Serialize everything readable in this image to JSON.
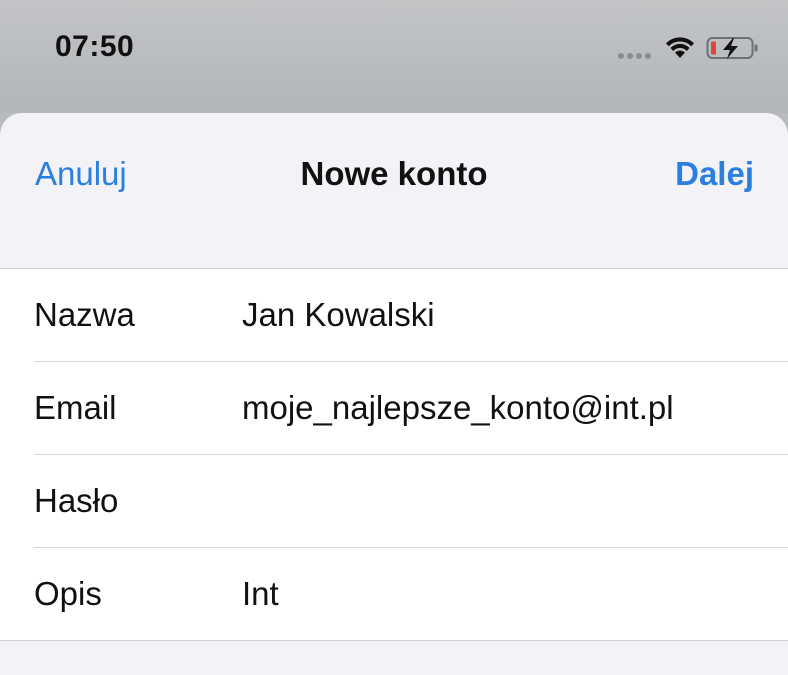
{
  "status_bar": {
    "time": "07:50",
    "icons": [
      "cellular-signal-icon",
      "wifi-icon",
      "battery-charging-icon"
    ],
    "battery_color": "#e5403a"
  },
  "nav": {
    "cancel_label": "Anuluj",
    "title": "Nowe konto",
    "next_label": "Dalej",
    "accent_color": "#2a7fe0"
  },
  "form": {
    "rows": [
      {
        "label": "Nazwa",
        "value": "Jan Kowalski"
      },
      {
        "label": "Email",
        "value": "moje_najlepsze_konto@int.pl"
      },
      {
        "label": "Hasło",
        "value": ""
      },
      {
        "label": "Opis",
        "value": "Int"
      }
    ]
  }
}
